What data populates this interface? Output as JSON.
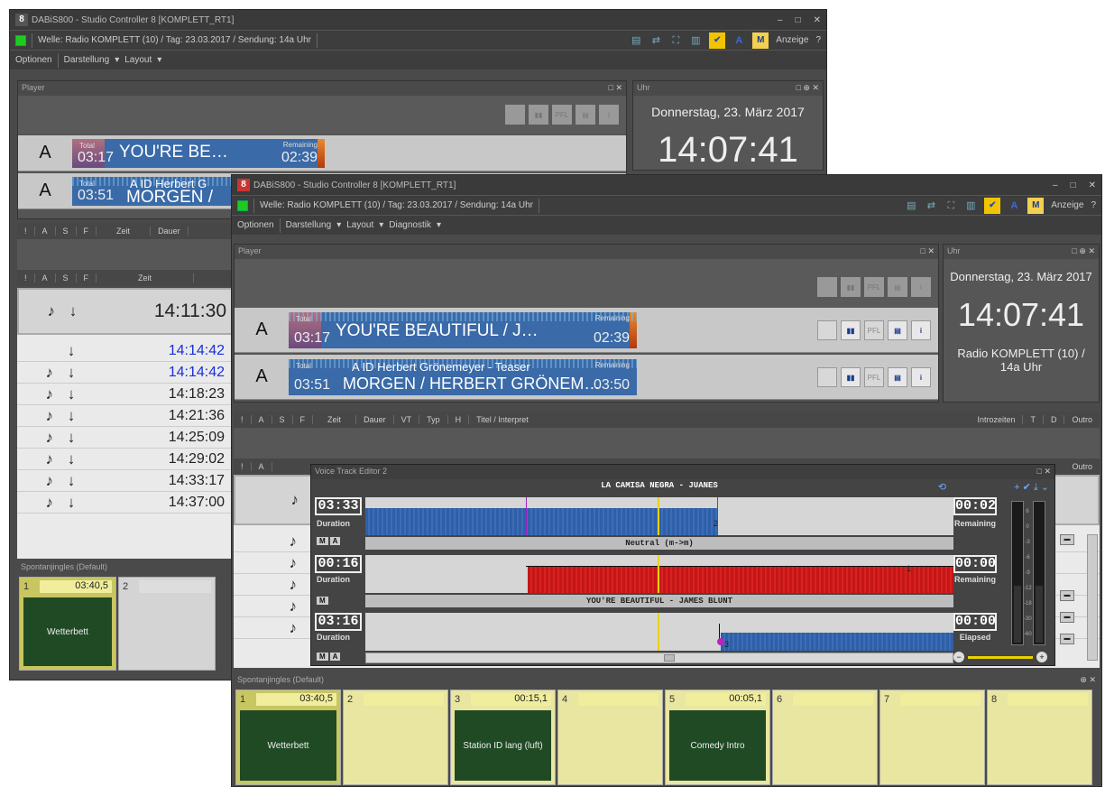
{
  "back": {
    "title": "DABiS800 - Studio Controller 8 [KOMPLETT_RT1]",
    "welle": "Welle: Radio KOMPLETT (10) / Tag: 23.03.2017 / Sendung: 14a Uhr",
    "menu": [
      "Optionen",
      "Darstellung",
      "Layout"
    ],
    "anzeige": "Anzeige",
    "help": "?",
    "player_label": "Player",
    "uhr_label": "Uhr",
    "date": "Donnerstag, 23. März 2017",
    "time": "14:07:41",
    "players": [
      {
        "letter": "A",
        "total_label": "Total",
        "total": "03:17",
        "title": "YOU'RE BE…",
        "remaining_label": "Remaining",
        "remaining": "02:39"
      },
      {
        "letter": "A",
        "total_label": "Total",
        "total": "03:51",
        "title": "MORGEN /",
        "subtitle": "A ID Herbert G",
        "remaining_label": "",
        "remaining": ""
      }
    ],
    "col_headers": [
      "!",
      "A",
      "S",
      "F",
      "Zeit",
      "Dauer"
    ],
    "big_row_time": "14:11:30",
    "rows": [
      {
        "note": "",
        "time": "14:14:42",
        "blue": true
      },
      {
        "note": "♪",
        "time": "14:14:42",
        "blue": true
      },
      {
        "note": "♪",
        "time": "14:18:23",
        "blue": false
      },
      {
        "note": "♪",
        "time": "14:21:36",
        "blue": false
      },
      {
        "note": "♪",
        "time": "14:25:09",
        "blue": false
      },
      {
        "note": "♪",
        "time": "14:29:02",
        "blue": false
      },
      {
        "note": "♪",
        "time": "14:33:17",
        "blue": false
      },
      {
        "note": "♪",
        "time": "14:37:00",
        "blue": false
      }
    ],
    "jingle_label": "Spontanjingles (Default)",
    "jingles": [
      {
        "num": "1",
        "time": "03:40,5",
        "name": "Wetterbett"
      },
      {
        "num": "2",
        "time": "",
        "name": ""
      }
    ]
  },
  "front": {
    "title": "DABiS800 - Studio Controller 8 [KOMPLETT_RT1]",
    "welle": "Welle: Radio KOMPLETT (10) / Tag: 23.03.2017 / Sendung: 14a Uhr",
    "menu": [
      "Optionen",
      "Darstellung",
      "Layout",
      "Diagnostik"
    ],
    "anzeige": "Anzeige",
    "help": "?",
    "player_label": "Player",
    "uhr_label": "Uhr",
    "date": "Donnerstag, 23. März 2017",
    "time": "14:07:41",
    "station": "Radio KOMPLETT (10) / 14a Uhr",
    "players": [
      {
        "letter": "A",
        "total_label": "Total",
        "total": "03:17",
        "title": "YOU'RE BEAUTIFUL / J…",
        "remaining_label": "Remaining",
        "remaining": "02:39"
      },
      {
        "letter": "A",
        "total_label": "Total",
        "total": "03:51",
        "title": "MORGEN / HERBERT GRÖNEM…",
        "subtitle": "A ID Herbert Grönemeyer - Teaser",
        "remaining_label": "Remaining",
        "remaining": "03:50"
      }
    ],
    "col_headers": [
      "!",
      "A",
      "S",
      "F",
      "Zeit",
      "Dauer",
      "VT",
      "Typ",
      "H",
      "Titel / Interpret"
    ],
    "col_headers_right": [
      "Introzeiten",
      "T",
      "D",
      "Outro"
    ],
    "col_headers2": [
      "!",
      "A"
    ],
    "outro2": "Outro",
    "jingle_label": "Spontanjingles (Default)",
    "jingles": [
      {
        "num": "1",
        "time": "03:40,5",
        "name": "Wetterbett"
      },
      {
        "num": "2",
        "time": "",
        "name": ""
      },
      {
        "num": "3",
        "time": "00:15,1",
        "name": "Station ID lang (luft)"
      },
      {
        "num": "4",
        "time": "",
        "name": ""
      },
      {
        "num": "5",
        "time": "00:05,1",
        "name": "Comedy Intro"
      },
      {
        "num": "6",
        "time": "",
        "name": ""
      },
      {
        "num": "7",
        "time": "",
        "name": ""
      },
      {
        "num": "8",
        "time": "",
        "name": ""
      }
    ]
  },
  "vte": {
    "title": "Voice Track Editor 2",
    "tracks": [
      {
        "name": "LA CAMISA NEGRA - JUANES",
        "duration": "03:33",
        "dur_label": "Duration",
        "right": "00:02",
        "right_label": "Remaining",
        "marker": "2"
      },
      {
        "name": "Neutral (m->m)",
        "duration": "00:16",
        "dur_label": "Duration",
        "right": "00:00",
        "right_label": "Remaining",
        "marker": "1"
      },
      {
        "name": "YOU'RE BEAUTIFUL - JAMES BLUNT",
        "duration": "03:16",
        "dur_label": "Duration",
        "right": "00:00",
        "right_label": "Elapsed",
        "marker": "3"
      }
    ],
    "meter_scale": [
      "6",
      "0",
      "-3",
      "-6",
      "-9",
      "-12",
      "-18",
      "-30",
      "-60"
    ],
    "m_label": "M",
    "a_label": "A"
  }
}
